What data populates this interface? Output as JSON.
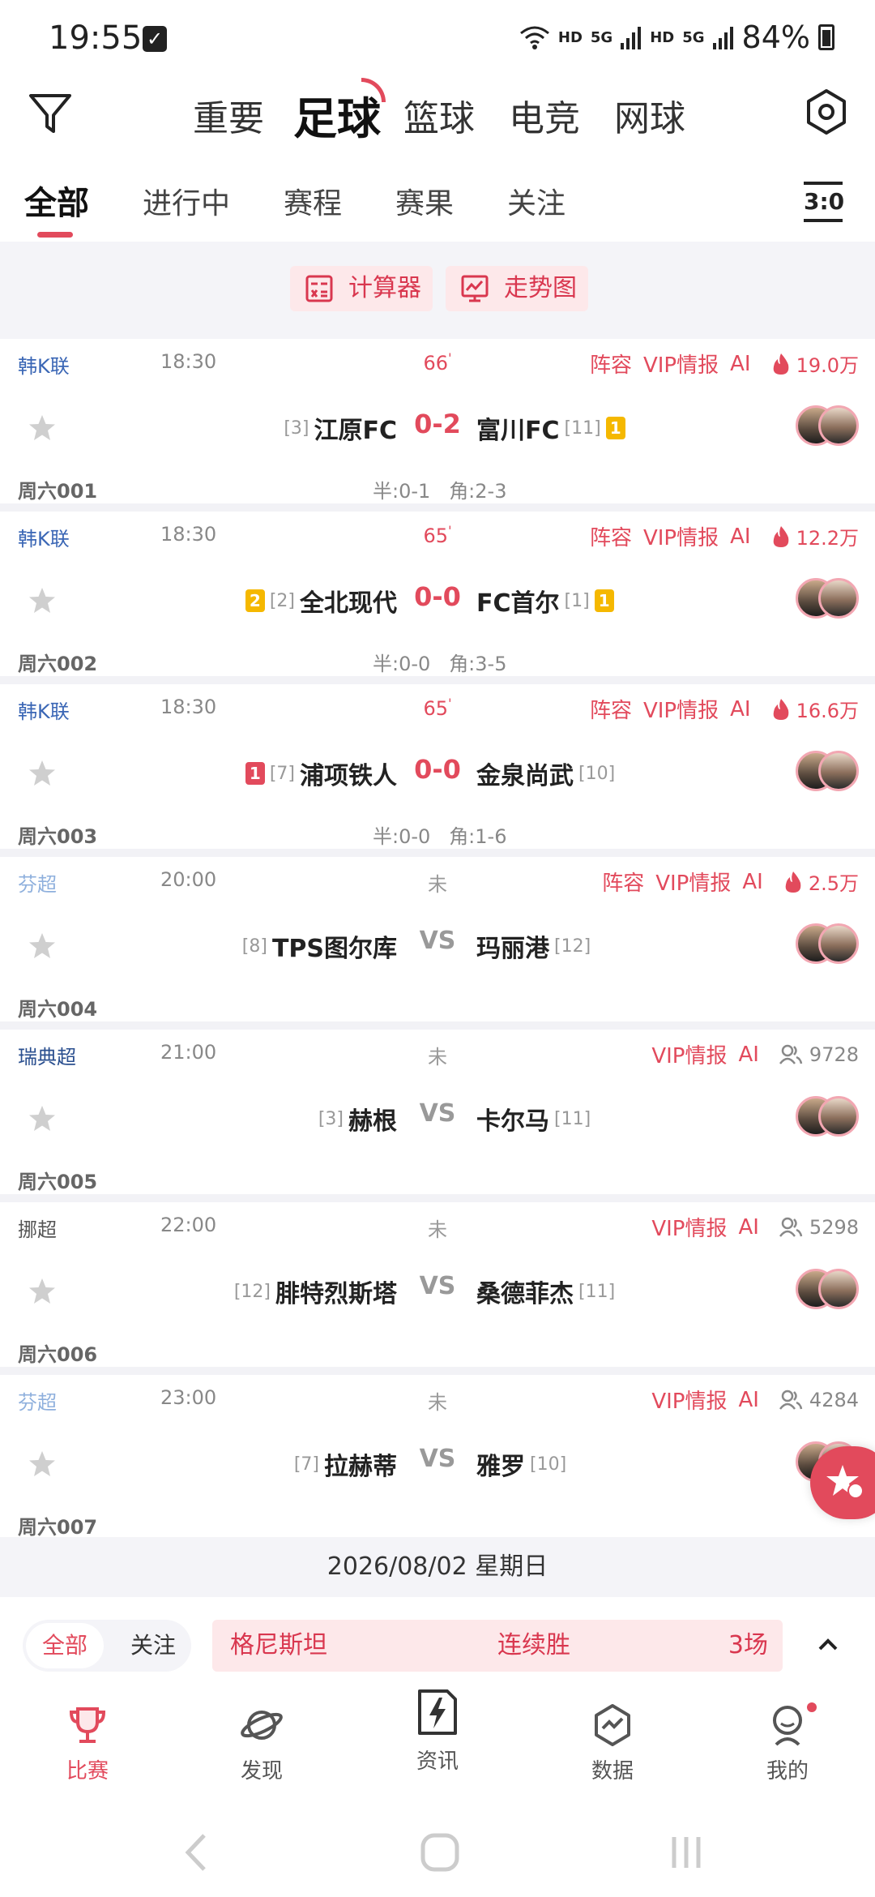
{
  "status_bar": {
    "time": "19:55",
    "hd1": "HD",
    "net1": "5G",
    "hd2": "HD",
    "net2": "5G",
    "battery": "84%"
  },
  "sport_tabs": [
    "重要",
    "足球",
    "篮球",
    "电竞",
    "网球"
  ],
  "sub_tabs": [
    "全部",
    "进行中",
    "赛程",
    "赛果",
    "关注"
  ],
  "score_icon": "3:0",
  "tools": {
    "calculator": "计算器",
    "trend": "走势图"
  },
  "matches": [
    {
      "league": "韩K联",
      "league_color": "#3a66b5",
      "time": "18:30",
      "status": "66",
      "tag_lineup": "阵容",
      "tag_vip": "VIP情报",
      "tag_ai": "AI",
      "heat": "19.0万",
      "home": "江原FC",
      "home_rank": "[3]",
      "score": "0-2",
      "away": "富川FC",
      "away_rank": "[11]",
      "away_card": "1",
      "round": "周六001",
      "half": "半:0-1",
      "corner": "角:2-3"
    },
    {
      "league": "韩K联",
      "league_color": "#3a66b5",
      "time": "18:30",
      "status": "65",
      "tag_lineup": "阵容",
      "tag_vip": "VIP情报",
      "tag_ai": "AI",
      "heat": "12.2万",
      "home": "全北现代",
      "home_rank": "[2]",
      "home_card": "2",
      "score": "0-0",
      "away": "FC首尔",
      "away_rank": "[1]",
      "away_card": "1",
      "round": "周六002",
      "half": "半:0-0",
      "corner": "角:3-5"
    },
    {
      "league": "韩K联",
      "league_color": "#3a66b5",
      "time": "18:30",
      "status": "65",
      "tag_lineup": "阵容",
      "tag_vip": "VIP情报",
      "tag_ai": "AI",
      "heat": "16.6万",
      "home": "浦项铁人",
      "home_rank": "[7]",
      "home_card": "1",
      "score": "0-0",
      "away": "金泉尚武",
      "away_rank": "[10]",
      "round": "周六003",
      "half": "半:0-0",
      "corner": "角:1-6"
    },
    {
      "league": "芬超",
      "league_color": "#8fb0dd",
      "time": "20:00",
      "status": "未",
      "tag_lineup": "阵容",
      "tag_vip": "VIP情报",
      "tag_ai": "AI",
      "heat": "2.5万",
      "home": "TPS图尔库",
      "home_rank": "[8]",
      "score": "VS",
      "away": "玛丽港",
      "away_rank": "[12]",
      "round": "周六004"
    },
    {
      "league": "瑞典超",
      "league_color": "#2a4f8f",
      "time": "21:00",
      "status": "未",
      "tag_vip": "VIP情报",
      "tag_ai": "AI",
      "viewers": "9728",
      "home": "赫根",
      "home_rank": "[3]",
      "score": "VS",
      "away": "卡尔马",
      "away_rank": "[11]",
      "round": "周六005"
    },
    {
      "league": "挪超",
      "league_color": "#555555",
      "time": "22:00",
      "status": "未",
      "tag_vip": "VIP情报",
      "tag_ai": "AI",
      "viewers": "5298",
      "home": "腓特烈斯塔",
      "home_rank": "[12]",
      "score": "VS",
      "away": "桑德菲杰",
      "away_rank": "[11]",
      "round": "周六006"
    },
    {
      "league": "芬超",
      "league_color": "#8fb0dd",
      "time": "23:00",
      "status": "未",
      "tag_vip": "VIP情报",
      "tag_ai": "AI",
      "viewers": "4284",
      "home": "拉赫蒂",
      "home_rank": "[7]",
      "score": "VS",
      "away": "雅罗",
      "away_rank": "[10]",
      "round": "周六007"
    }
  ],
  "date_bar": "2026/08/02 星期日",
  "streak": {
    "seg_all": "全部",
    "seg_follow": "关注",
    "team": "格尼斯坦",
    "type": "连续胜",
    "count": "3场"
  },
  "bottom_nav": [
    "比赛",
    "发现",
    "资讯",
    "数据",
    "我的"
  ],
  "colors": {
    "accent": "#e24a5c",
    "accent_bg": "#fde8ea",
    "page_bg": "#f4f4f8"
  },
  "icons": [
    "filter-icon",
    "settings-icon",
    "calculator-icon",
    "trend-icon",
    "fire-icon",
    "viewers-icon",
    "star-icon",
    "trophy-icon",
    "planet-icon",
    "news-icon",
    "chart-icon",
    "profile-icon"
  ]
}
